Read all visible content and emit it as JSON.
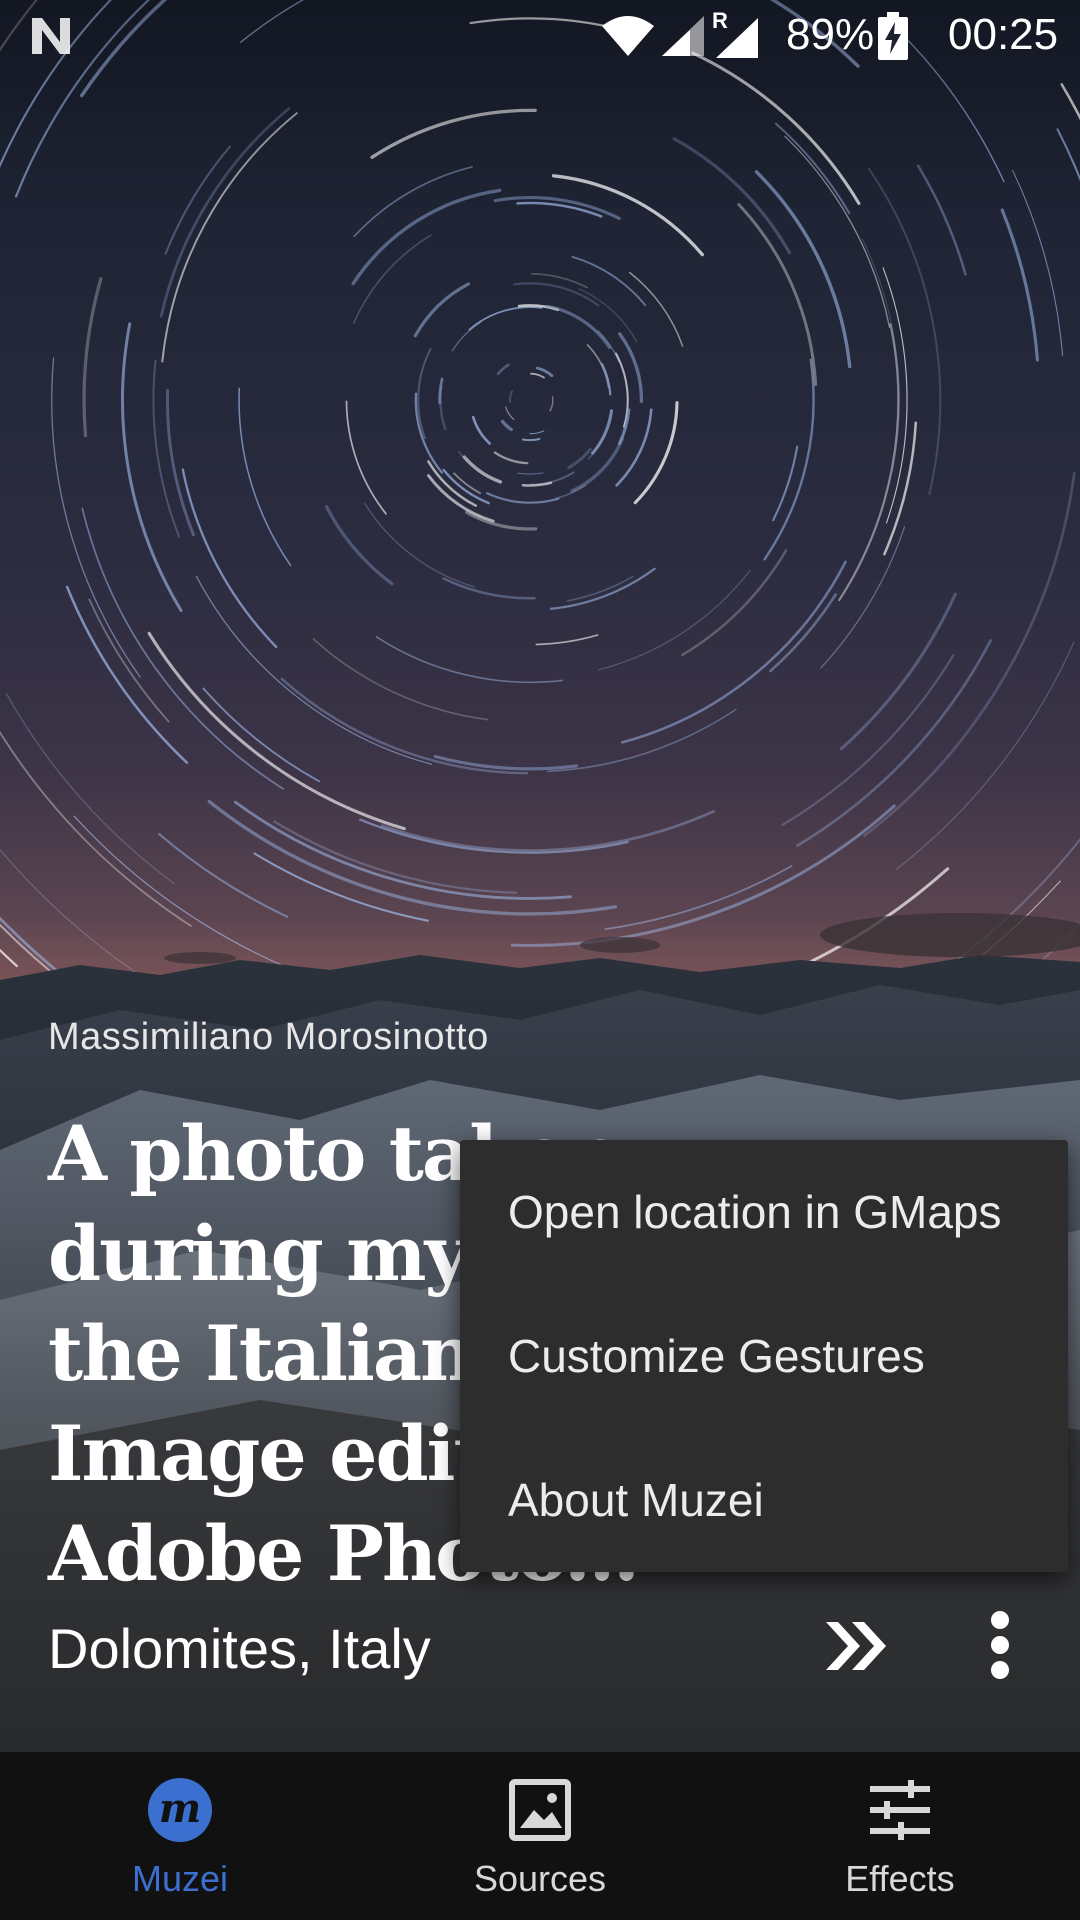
{
  "status_bar": {
    "battery_percent": "89%",
    "time": "00:25",
    "signal_roaming_label": "R",
    "icons": [
      "notification-n-icon",
      "wifi-icon",
      "cell-signal-icon",
      "cell-signal-roaming-icon",
      "battery-charging-icon"
    ]
  },
  "artwork": {
    "byline": "Massimiliano Morosinotto",
    "title_lines": [
      "A photo taken",
      "during my tr",
      "the Italian A",
      "Image edite",
      "Adobe Photo..."
    ],
    "location": "Dolomites, Italy",
    "next_icon": "next-artwork-icon",
    "overflow_icon": "more-vert-icon"
  },
  "menu": {
    "items": [
      "Open location in GMaps",
      "Customize Gestures",
      "About Muzei"
    ]
  },
  "bottom_nav": {
    "active_color": "#3b6fd0",
    "inactive_color": "#d8d8d8",
    "tabs": [
      {
        "label": "Muzei",
        "icon": "muzei-logo-icon",
        "active": true
      },
      {
        "label": "Sources",
        "icon": "image-icon",
        "active": false
      },
      {
        "label": "Effects",
        "icon": "tune-icon",
        "active": false
      }
    ]
  }
}
